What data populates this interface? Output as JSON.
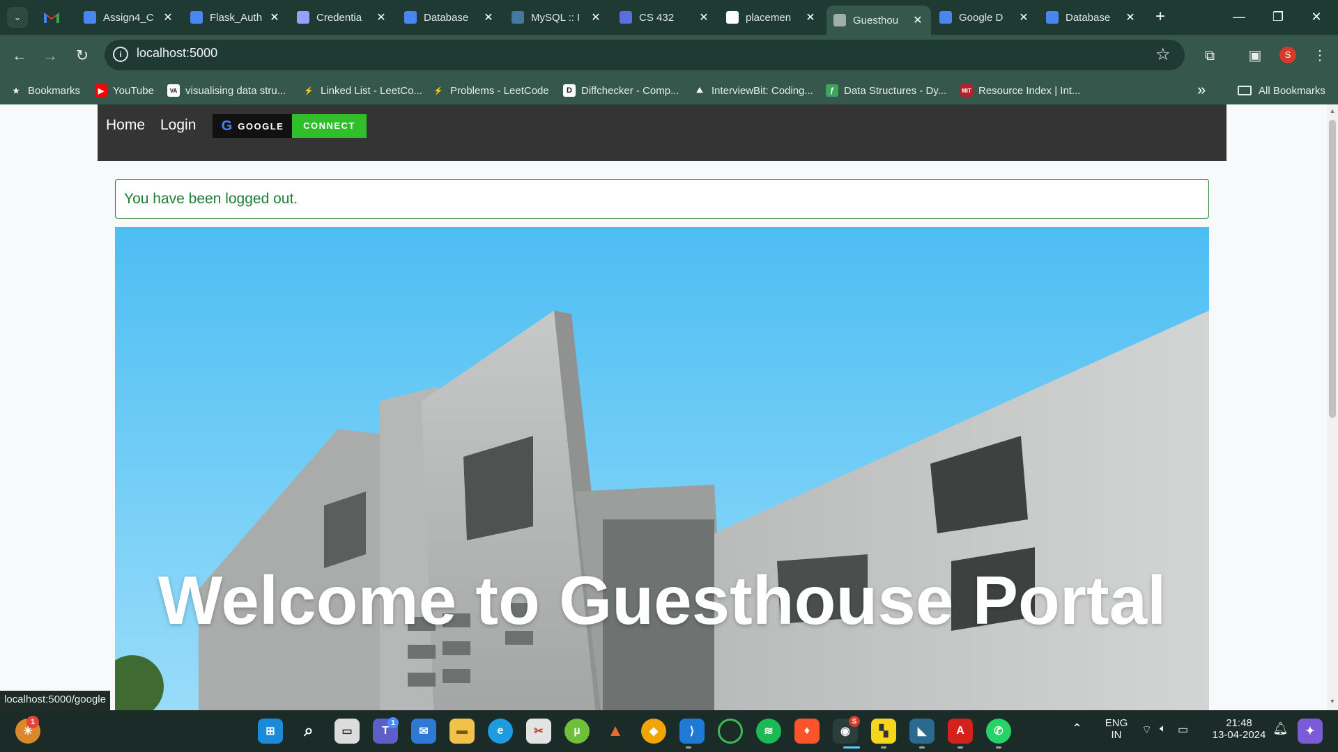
{
  "browser": {
    "tabs": [
      {
        "title": "Assign4_C",
        "favicon": "docs-icon",
        "color": "#4a86f0"
      },
      {
        "title": "Flask_Auth",
        "favicon": "docs-icon",
        "color": "#4a86f0"
      },
      {
        "title": "Credentia",
        "favicon": "api-icon",
        "color": "#8fa3ff"
      },
      {
        "title": "Database",
        "favicon": "docs-icon",
        "color": "#4a86f0"
      },
      {
        "title": "MySQL :: I",
        "favicon": "mysql-icon",
        "color": "#4479a1"
      },
      {
        "title": "CS 432",
        "favicon": "classroom-icon",
        "color": "#5b6ee0"
      },
      {
        "title": "placemen",
        "favicon": "github-icon",
        "color": "#ffffff"
      },
      {
        "title": "Guesthou",
        "favicon": "globe-icon",
        "color": "#9fb0aa"
      },
      {
        "title": "Google D",
        "favicon": "docs-icon",
        "color": "#4a86f0"
      },
      {
        "title": "Database",
        "favicon": "docs-icon",
        "color": "#4a86f0"
      }
    ],
    "active_tab_index": 7,
    "address": "localhost:5000",
    "profile_initial": "S",
    "bookmarks": [
      {
        "label": "Bookmarks",
        "icon": "star-icon"
      },
      {
        "label": "YouTube",
        "icon": "youtube-icon"
      },
      {
        "label": "visualising data stru...",
        "icon": "visualgo-icon"
      },
      {
        "label": "Linked List - LeetCo...",
        "icon": "leetcode-icon"
      },
      {
        "label": "Problems - LeetCode",
        "icon": "leetcode-icon"
      },
      {
        "label": "Diffchecker - Comp...",
        "icon": "diffchecker-icon"
      },
      {
        "label": "InterviewBit: Coding...",
        "icon": "interviewbit-icon"
      },
      {
        "label": "Data Structures - Dy...",
        "icon": "ds-icon"
      },
      {
        "label": "Resource Index | Int...",
        "icon": "mit-icon"
      }
    ],
    "all_bookmarks_label": "All Bookmarks",
    "status_text": "localhost:5000/google"
  },
  "site": {
    "nav": {
      "home": "Home",
      "login": "Login",
      "google_label": "GOOGLE",
      "connect_label": "CONNECT"
    },
    "alert": "You have been logged out.",
    "hero_title": "Welcome to Guesthouse Portal"
  },
  "taskbar": {
    "weather_badge": "1",
    "teams_badge": "1",
    "chrome_badge": "S",
    "language_line1": "ENG",
    "language_line2": "IN",
    "time": "21:48",
    "date": "13-04-2024"
  },
  "colors": {
    "navbar": "#343434",
    "connect": "#2fbf2a",
    "alert_green": "#1e7e34",
    "browser_frame": "#35574c"
  }
}
